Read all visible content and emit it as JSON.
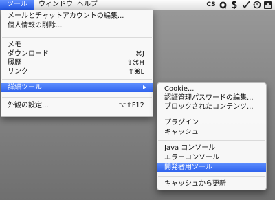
{
  "menubar": {
    "tools": "ツール",
    "window": "ウィンドウ",
    "help": "ヘルプ",
    "status_cs": "CS"
  },
  "tools_menu": {
    "edit_mail_chat": "メールとチャットアカウントの編集...",
    "delete_personal": "個人情報の削除...",
    "memo": "メモ",
    "downloads": "ダウンロード",
    "downloads_shortcut": "⌘J",
    "history": "履歴",
    "history_shortcut": "⇧⌘H",
    "links": "リンク",
    "links_shortcut": "⇧⌘L",
    "advanced": "詳細ツール",
    "appearance": "外観の設定...",
    "appearance_shortcut": "⌥⇧F12"
  },
  "advanced_menu": {
    "cookie": "Cookie...",
    "passwords": "認証管理パスワードの編集...",
    "blocked": "ブロックされたコンテンツ...",
    "plugins": "プラグイン",
    "cache": "キャッシュ",
    "java_console": "Java コンソール",
    "error_console": "エラーコンソール",
    "dev_tools": "開発者用ツール",
    "reload_cache": "キャッシュから更新"
  }
}
